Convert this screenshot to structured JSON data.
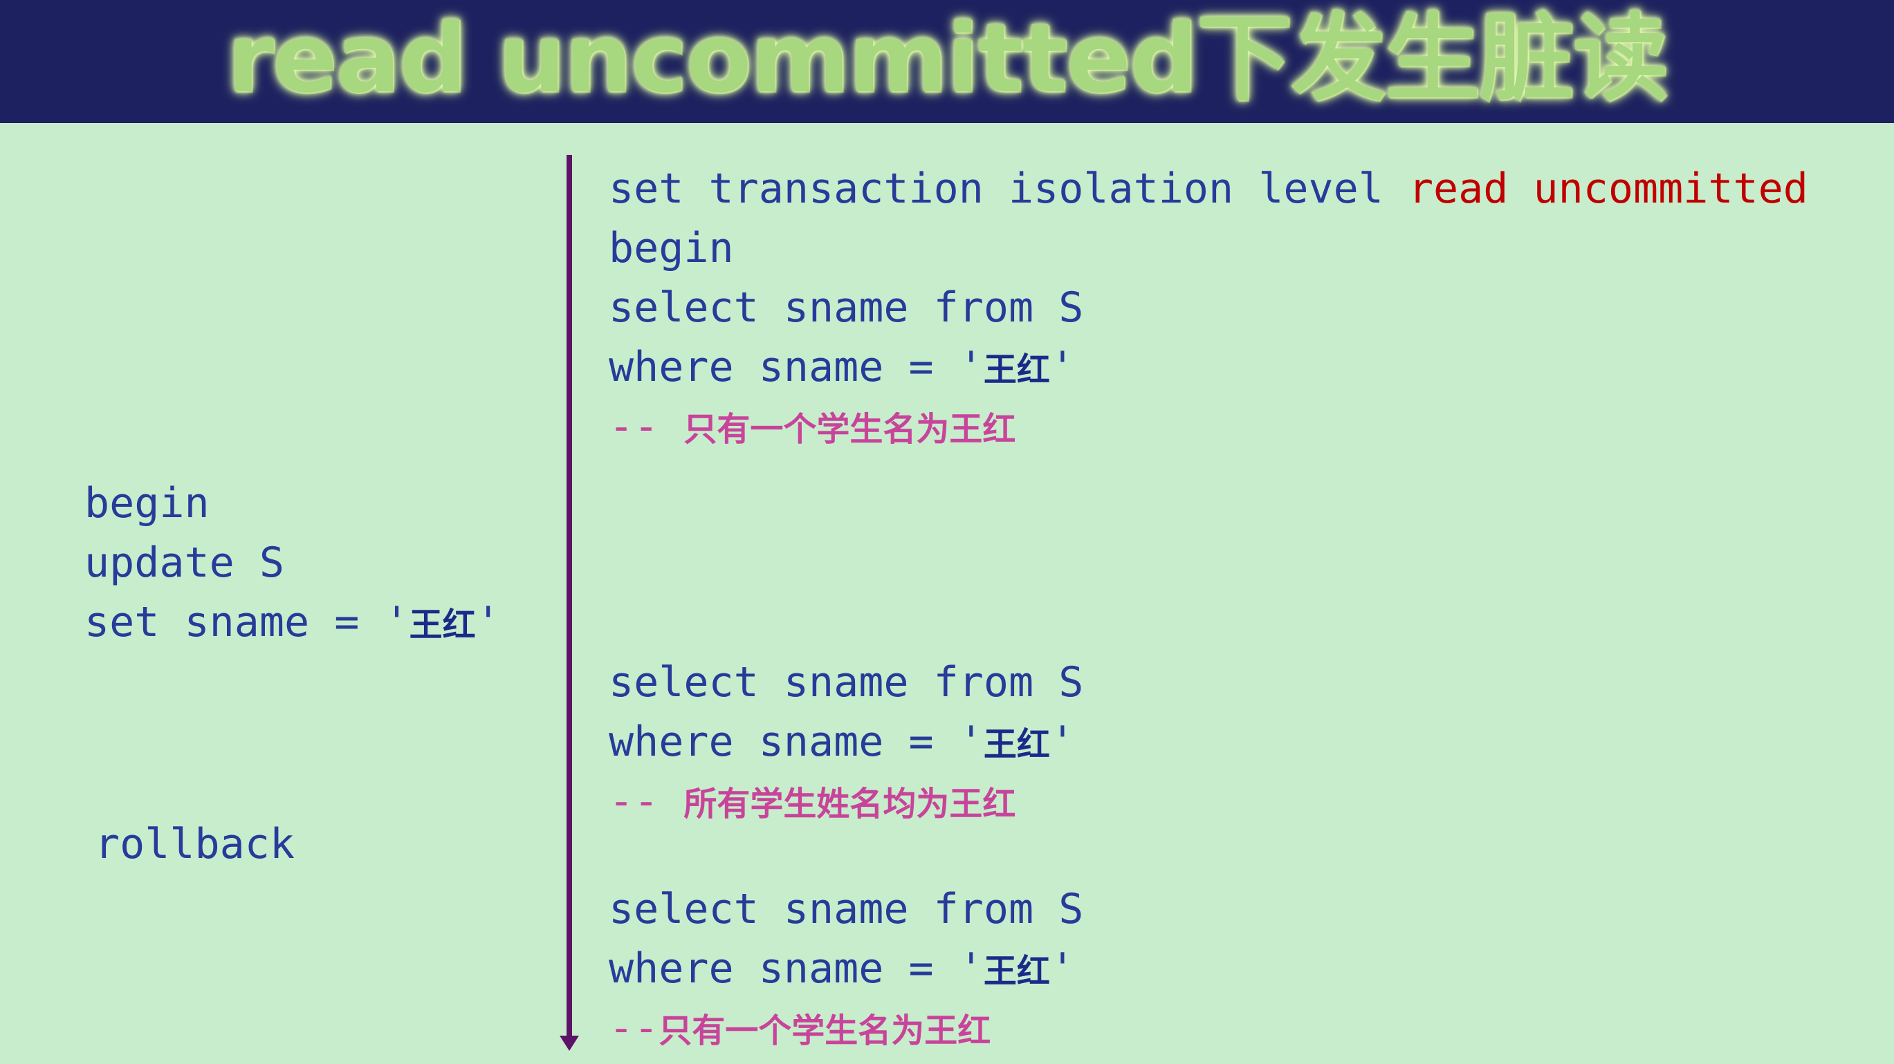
{
  "title": "read uncommitted下发生脏读",
  "right_column": {
    "block1": {
      "line1_prefix": "set transaction isolation level ",
      "line1_highlight": "read uncommitted",
      "line2": "begin",
      "line3": "select sname from S",
      "line4_prefix": "where sname = '",
      "line4_name": "王红",
      "line4_suffix": "'",
      "comment_prefix": "-- ",
      "comment_text": "只有一个学生名为王红"
    },
    "block2": {
      "line1": "select sname from S",
      "line2_prefix": "where sname = '",
      "line2_name": "王红",
      "line2_suffix": "'",
      "comment_prefix": "-- ",
      "comment_text": "所有学生姓名均为王红"
    },
    "block3": {
      "line1": "select sname from S",
      "line2_prefix": "where sname = '",
      "line2_name": "王红",
      "line2_suffix": "'",
      "comment_prefix": "--",
      "comment_text": "只有一个学生名为王红"
    }
  },
  "left_column": {
    "line1": "begin",
    "line2": "update S",
    "line3_prefix": "set sname = '",
    "line3_name": "王红",
    "line3_suffix": "'",
    "rollback": "rollback"
  },
  "colors": {
    "background": "#c8edcc",
    "title_bar": "#1d2160",
    "title_text": "#a7d77e",
    "code_text": "#283b9a",
    "keyword_highlight": "#c00000",
    "comment": "#c8449b",
    "timeline": "#5c1466"
  }
}
